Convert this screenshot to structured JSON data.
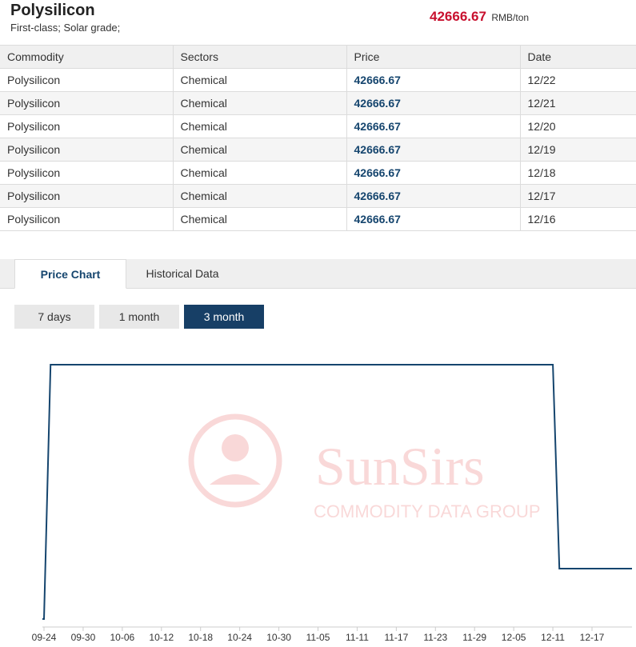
{
  "header": {
    "title": "Polysilicon",
    "subtitle": "First-class; Solar grade;",
    "price": "42666.67",
    "unit": "RMB/ton"
  },
  "table": {
    "columns": [
      "Commodity",
      "Sectors",
      "Price",
      "Date"
    ],
    "rows": [
      [
        "Polysilicon",
        "Chemical",
        "42666.67",
        "12/22"
      ],
      [
        "Polysilicon",
        "Chemical",
        "42666.67",
        "12/21"
      ],
      [
        "Polysilicon",
        "Chemical",
        "42666.67",
        "12/20"
      ],
      [
        "Polysilicon",
        "Chemical",
        "42666.67",
        "12/19"
      ],
      [
        "Polysilicon",
        "Chemical",
        "42666.67",
        "12/18"
      ],
      [
        "Polysilicon",
        "Chemical",
        "42666.67",
        "12/17"
      ],
      [
        "Polysilicon",
        "Chemical",
        "42666.67",
        "12/16"
      ]
    ]
  },
  "tabs": [
    "Price Chart",
    "Historical Data"
  ],
  "range_buttons": [
    "7 days",
    "1 month",
    "3 month"
  ],
  "selected_range": "3 month",
  "watermark": {
    "brand": "SunSirs",
    "tagline": "COMMODITY DATA GROUP"
  },
  "colors": {
    "accent": "#173f66",
    "price_red": "#c8102e",
    "line": "#15456e"
  },
  "chart_data": {
    "type": "line",
    "title": "",
    "xlabel": "",
    "ylabel": "",
    "tick_labels": [
      "09-24",
      "09-30",
      "10-06",
      "10-12",
      "10-18",
      "10-24",
      "10-30",
      "11-05",
      "11-11",
      "11-17",
      "11-23",
      "11-29",
      "12-05",
      "12-11",
      "12-17"
    ],
    "y_axis_labels": "none",
    "grid": false,
    "series": [
      {
        "x": [
          "09-23",
          "09-24",
          "09-25",
          "12-11",
          "12-12",
          "12-22"
        ],
        "y": [
          "low",
          "low",
          "high",
          "high",
          "mid",
          "mid"
        ]
      }
    ]
  }
}
